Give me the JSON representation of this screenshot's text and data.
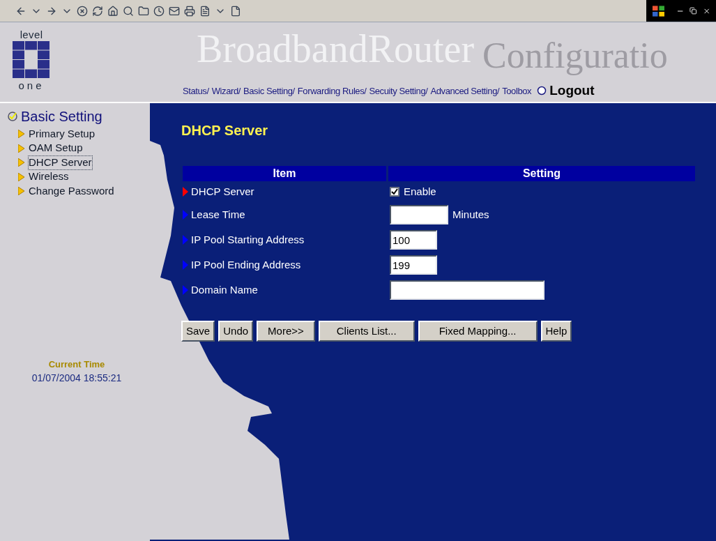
{
  "header": {
    "logo_top": "level",
    "logo_bottom": "one",
    "title": "BroadbandRouter",
    "subtitle": "Configuratio",
    "nav": [
      {
        "label": "Status/"
      },
      {
        "label": "Wizard/"
      },
      {
        "label": "Basic Setting/"
      },
      {
        "label": "Forwarding Rules/"
      },
      {
        "label": "Secuity Setting/"
      },
      {
        "label": "Advanced Setting/"
      },
      {
        "label": "Toolbox"
      }
    ],
    "logout": "Logout"
  },
  "sidebar": {
    "section": "Basic Setting",
    "items": [
      {
        "label": "Primary Setup",
        "selected": false
      },
      {
        "label": "OAM Setup",
        "selected": false
      },
      {
        "label": "DHCP Server",
        "selected": true
      },
      {
        "label": "Wireless",
        "selected": false
      },
      {
        "label": "Change Password",
        "selected": false
      }
    ],
    "time_label": "Current Time",
    "time": "01/07/2004 18:55:21"
  },
  "page_title": "DHCP Server",
  "table": {
    "columns": [
      "Item",
      "Setting"
    ],
    "rows": [
      {
        "label": "DHCP Server",
        "color": "#ff0000",
        "kind": "checkbox",
        "checked": true,
        "text": "Enable"
      },
      {
        "label": "Lease Time",
        "color": "#0000ff",
        "kind": "field",
        "unit": "Minutes"
      },
      {
        "label": "IP Pool Starting Address",
        "color": "#0000ff",
        "kind": "field",
        "value": "100"
      },
      {
        "label": "IP Pool Ending Address",
        "color": "#0000ff",
        "kind": "field",
        "value": "199"
      },
      {
        "label": "Domain Name",
        "color": "#0000ff",
        "kind": "field"
      }
    ]
  },
  "buttons": [
    "Save",
    "Undo",
    "More>>",
    "Clients List...",
    "Fixed Mapping...",
    "Help"
  ]
}
